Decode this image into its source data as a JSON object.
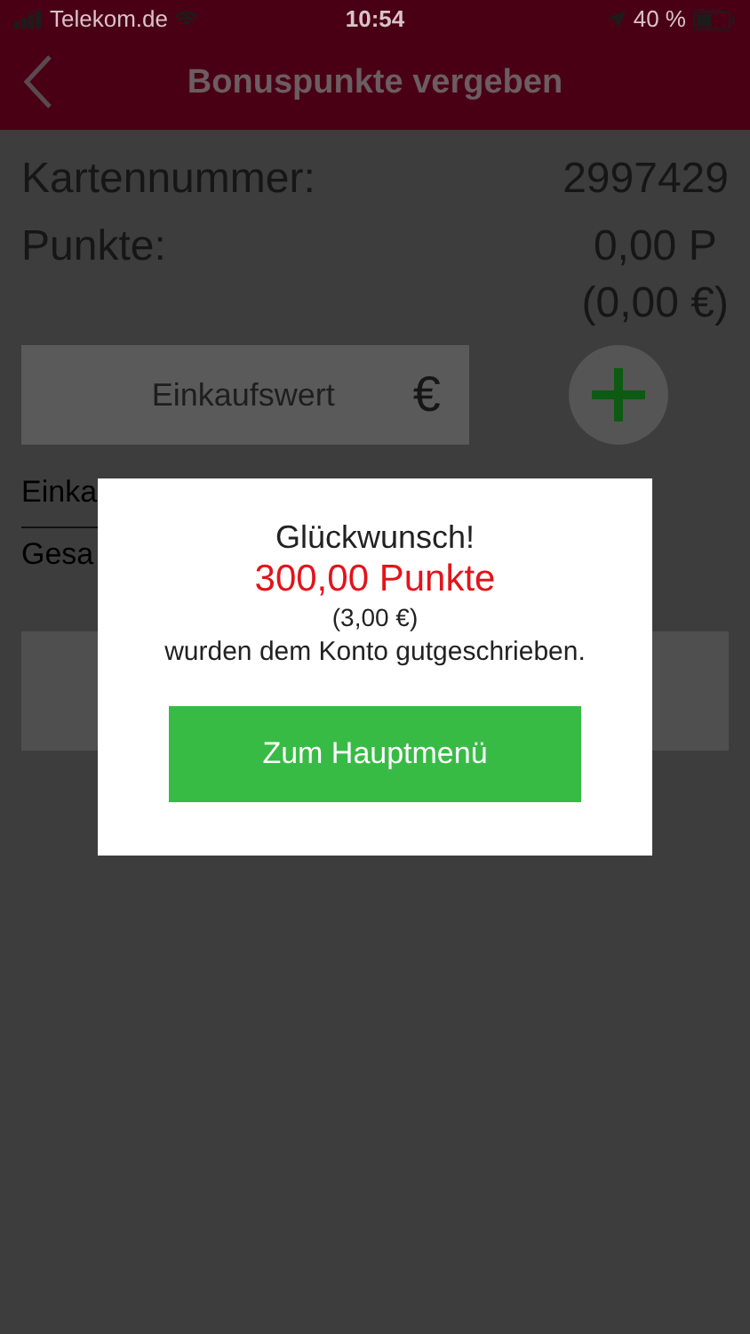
{
  "status_bar": {
    "carrier": "Telekom.de",
    "time": "10:54",
    "battery": "40 %"
  },
  "header": {
    "title": "Bonuspunkte vergeben"
  },
  "summary": [
    {
      "label": "Kartennummer:",
      "value": "2997429"
    },
    {
      "label": "Punkte:",
      "value": "0,00 P",
      "subvalue": "(0,00 €)"
    }
  ],
  "amount_field": {
    "placeholder": "Einkaufswert",
    "currency": "€"
  },
  "lines": [
    "Einka",
    "Gesa"
  ],
  "dialog": {
    "title": "Glückwunsch!",
    "points": "300,00 Punkte",
    "amount": "(3,00 €)",
    "message": "wurden dem Konto gutgeschrieben.",
    "button": "Zum Hauptmenü"
  }
}
